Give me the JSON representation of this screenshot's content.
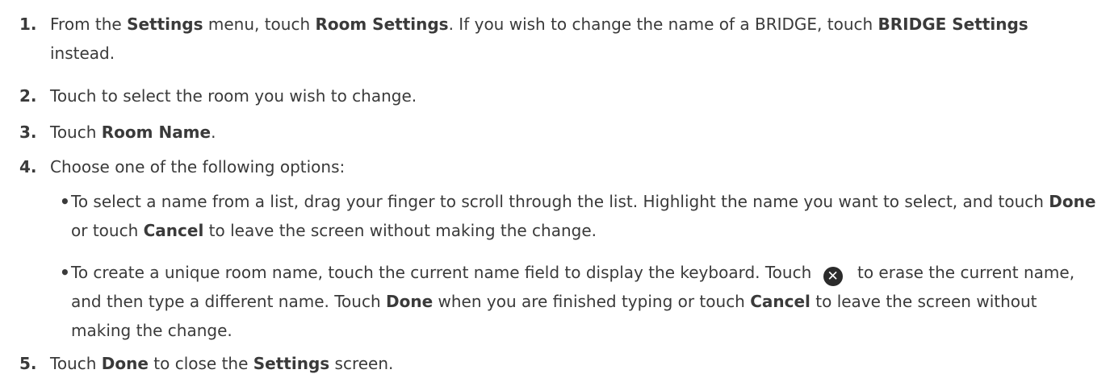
{
  "steps": [
    {
      "number": "1.",
      "parts": [
        "From the ",
        "Settings",
        " menu, touch ",
        "Room Settings",
        ". If you wish to change the name of a BRIDGE, touch ",
        "BRIDGE Settings",
        " instead."
      ]
    },
    {
      "number": "2.",
      "parts": [
        "Touch to select the room you wish to change."
      ]
    },
    {
      "number": "3.",
      "parts": [
        "Touch ",
        "Room Name",
        "."
      ]
    },
    {
      "number": "4.",
      "parts": [
        "Choose one of the following options:"
      ],
      "options": [
        {
          "bullet": "•",
          "parts": [
            "To select a name from a list, drag your finger to scroll through the list. Highlight the name you want to select, and touch ",
            "Done",
            " or touch ",
            "Cancel",
            " to leave the screen without making the change."
          ]
        },
        {
          "bullet": "•",
          "parts": [
            "To create a unique room name, touch the current name field to display the keyboard. Touch ",
            " to erase the current name, and then type a different name. Touch ",
            "Done",
            " when you are finished typing or touch ",
            "Cancel",
            " to leave the screen without making the change."
          ],
          "icon": "clear-x-circle-icon",
          "icon_glyph": "✕"
        }
      ]
    },
    {
      "number": "5.",
      "parts": [
        "Touch ",
        "Done",
        " to close the ",
        "Settings",
        " screen."
      ]
    }
  ],
  "colors": {
    "text": "#3a3a3a",
    "icon_bg": "#2b2b2b"
  }
}
